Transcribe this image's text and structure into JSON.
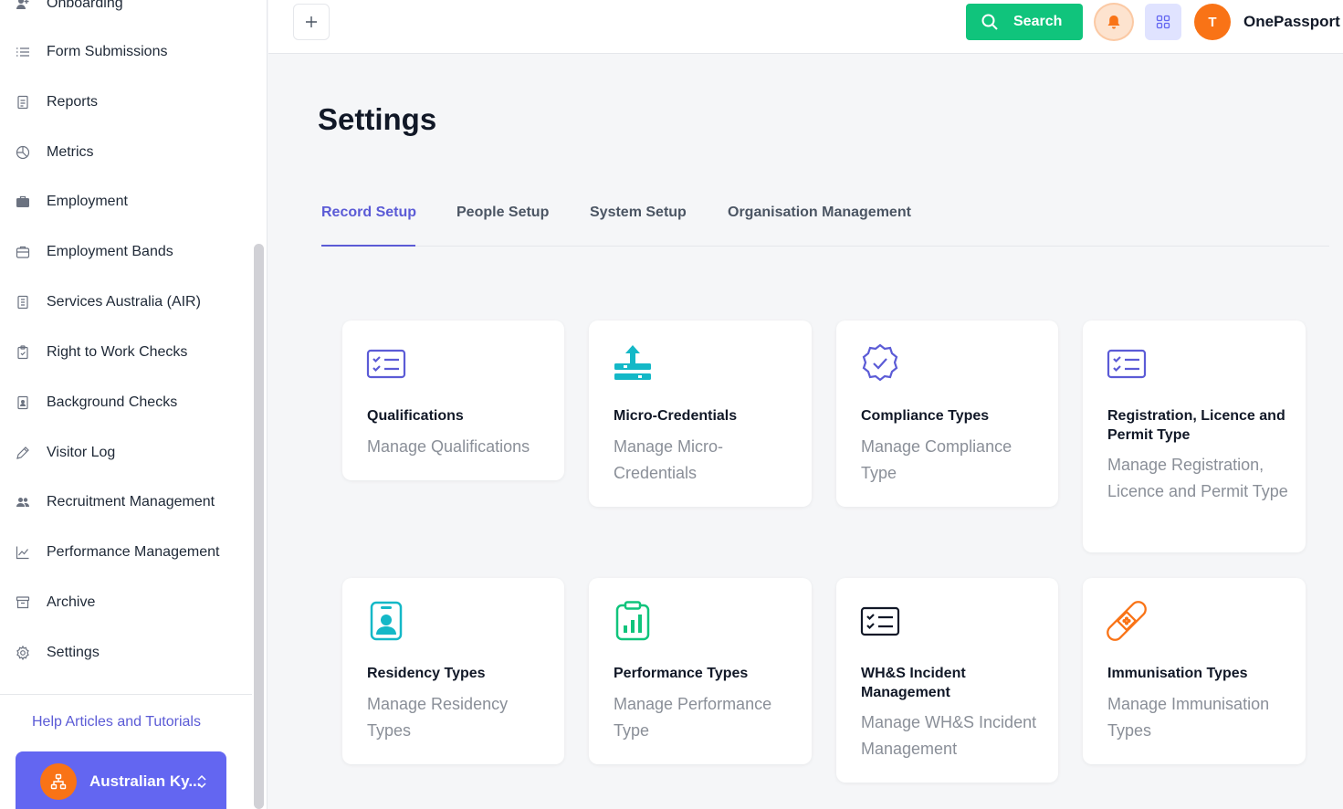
{
  "sidebar": {
    "items": [
      {
        "label": "Onboarding",
        "icon": "user-plus-icon"
      },
      {
        "label": "Form Submissions",
        "icon": "list-icon"
      },
      {
        "label": "Reports",
        "icon": "report-icon"
      },
      {
        "label": "Metrics",
        "icon": "pie-chart-icon"
      },
      {
        "label": "Employment",
        "icon": "briefcase-icon"
      },
      {
        "label": "Employment Bands",
        "icon": "briefcase-outline-icon"
      },
      {
        "label": "Services Australia (AIR)",
        "icon": "document-icon"
      },
      {
        "label": "Right to Work Checks",
        "icon": "clipboard-icon"
      },
      {
        "label": "Background Checks",
        "icon": "id-document-icon"
      },
      {
        "label": "Visitor Log",
        "icon": "pen-icon"
      },
      {
        "label": "Recruitment Management",
        "icon": "users-icon"
      },
      {
        "label": "Performance Management",
        "icon": "trend-chart-icon"
      },
      {
        "label": "Archive",
        "icon": "archive-icon"
      },
      {
        "label": "Settings",
        "icon": "gear-icon"
      }
    ],
    "help_link": "Help Articles and Tutorials",
    "org_name": "Australian Ky..."
  },
  "topbar": {
    "search_label": "Search",
    "user_initial": "T",
    "user_name": "OnePassport"
  },
  "main": {
    "title": "Settings",
    "tabs": [
      {
        "label": "Record Setup",
        "active": true
      },
      {
        "label": "People Setup",
        "active": false
      },
      {
        "label": "System Setup",
        "active": false
      },
      {
        "label": "Organisation Management",
        "active": false
      }
    ],
    "cards": [
      {
        "title": "Qualifications",
        "desc": "Manage Qualifications",
        "icon": "checklist-card-icon"
      },
      {
        "title": "Micro-Credentials",
        "desc": "Manage Micro-Credentials",
        "icon": "upload-stack-icon"
      },
      {
        "title": "Compliance Types",
        "desc": "Manage Compliance Type",
        "icon": "badge-check-icon"
      },
      {
        "title": "Registration, Licence and Permit Type",
        "desc": "Manage Registration, Licence and Permit Type",
        "icon": "checklist-card-icon"
      },
      {
        "title": "Residency Types",
        "desc": "Manage Residency Types",
        "icon": "id-badge-icon"
      },
      {
        "title": "Performance Types",
        "desc": "Manage Performance Type",
        "icon": "clipboard-chart-icon"
      },
      {
        "title": "WH&S Incident Management",
        "desc": "Manage WH&S Incident Management",
        "icon": "incident-list-icon"
      },
      {
        "title": "Immunisation Types",
        "desc": "Manage Immunisation Types",
        "icon": "bandage-icon"
      }
    ]
  },
  "colors": {
    "accent": "#5b5bd6",
    "search": "#10c47c",
    "avatar": "#f97316",
    "icon_teal": "#14b8c7",
    "icon_purple": "#5b5bd6",
    "icon_orange": "#f97316"
  }
}
